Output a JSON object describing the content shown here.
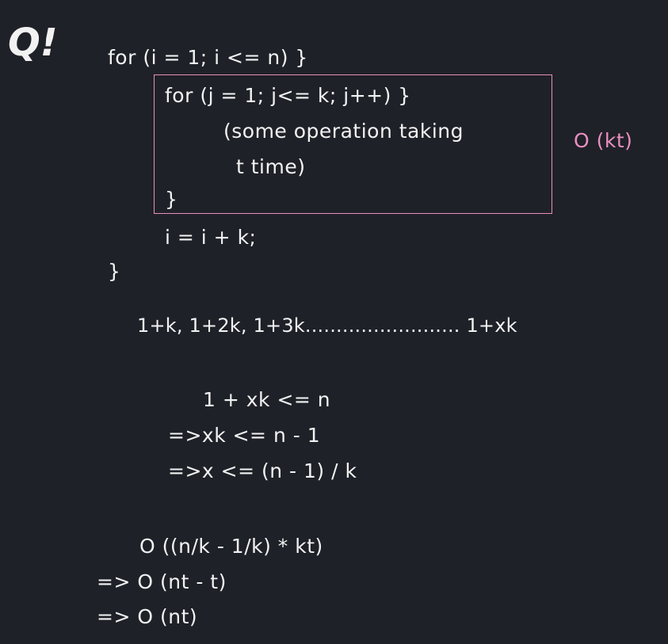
{
  "question_label": "Q!",
  "code": {
    "outer_for": "for (i = 1; i <= n) }",
    "inner_for": "for (j = 1; j<= k; j++) }",
    "op_line1": "(some operation taking",
    "op_line2": "t time)",
    "inner_close": "}",
    "increment": "i = i + k;",
    "outer_close": "}"
  },
  "inner_complexity": "O (kt)",
  "series": "1+k, 1+2k, 1+3k......................... 1+xk",
  "derivation": {
    "line1": "1 + xk <= n",
    "line2": "=>xk <= n - 1",
    "line3": "=>x <= (n - 1) / k"
  },
  "result": {
    "line1": "O ((n/k - 1/k) * kt)",
    "line2": "=> O (nt - t)",
    "line3": "=> O (nt)"
  },
  "colors": {
    "background": "#1f2128",
    "text": "#f2f2f2",
    "highlight": "#e58fbd"
  }
}
